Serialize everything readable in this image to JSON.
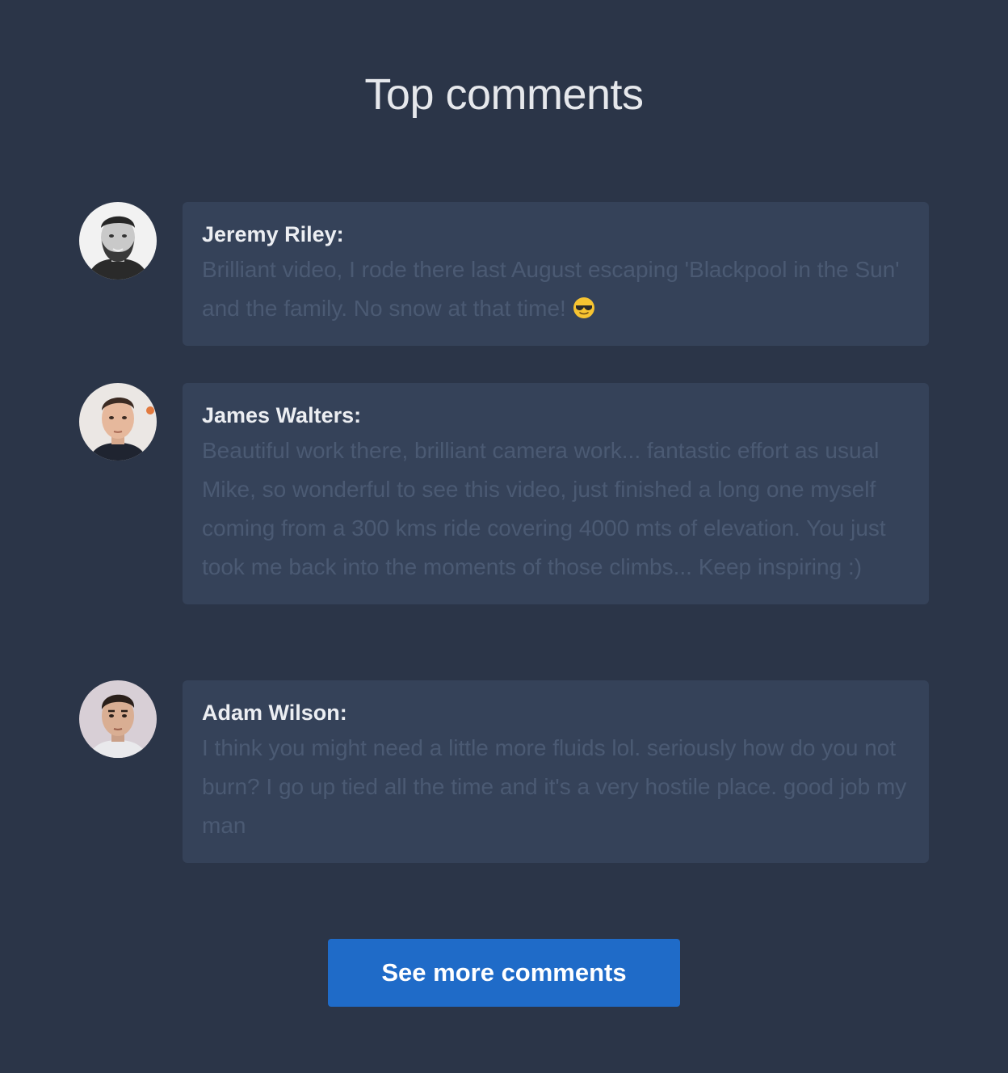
{
  "header": {
    "title": "Top comments"
  },
  "comments": [
    {
      "author": "Jeremy Riley:",
      "text": "Brilliant video, I rode there last August escaping 'Blackpool in the Sun' and the family. No snow at that time! ",
      "emoji": "sunglasses-emoji-icon"
    },
    {
      "author": "James Walters:",
      "text": "Beautiful work there, brilliant camera work... fantastic effort as usual Mike, so wonderful to see this video, just finished a long one myself coming from a 300 kms ride covering 4000 mts of elevation. You just took me back into the moments of those climbs... Keep inspiring :)"
    },
    {
      "author": "Adam Wilson:",
      "text": "I think you might need a little more fluids lol. seriously how do you not burn? I go up tied all the time and it's a very hostile place. good job my man"
    }
  ],
  "actions": {
    "more_label": "See more comments"
  },
  "colors": {
    "background": "#2b3548",
    "bubble": "#354259",
    "accent": "#1f6bc8"
  }
}
